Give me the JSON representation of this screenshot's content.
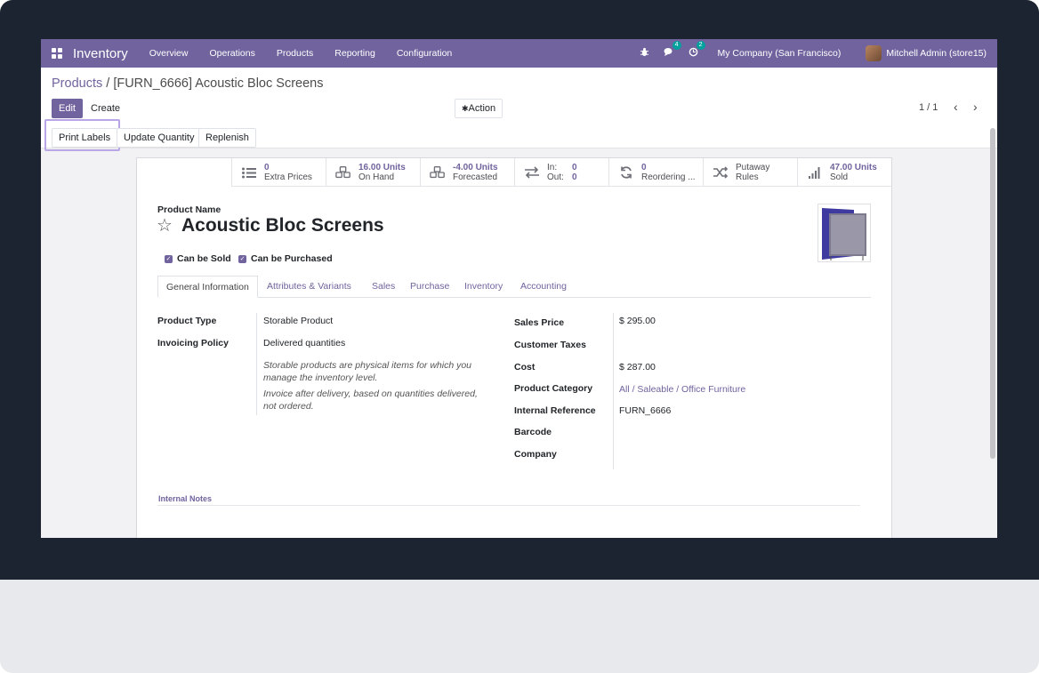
{
  "navbar": {
    "brand": "Inventory",
    "menu": [
      "Overview",
      "Operations",
      "Products",
      "Reporting",
      "Configuration"
    ],
    "messages_badge": "4",
    "activities_badge": "2",
    "company": "My Company (San Francisco)",
    "user": "Mitchell Admin (store15)"
  },
  "breadcrumb": {
    "parent": "Products",
    "separator": "/",
    "current": "[FURN_6666] Acoustic Bloc Screens"
  },
  "control": {
    "edit_label": "Edit",
    "create_label": "Create",
    "action_label": "Action",
    "pager": "1 / 1"
  },
  "statusbar": {
    "print_labels": "Print Labels",
    "update_quantity": "Update Quantity",
    "replenish": "Replenish"
  },
  "smart_buttons": {
    "extra_prices": {
      "value": "0",
      "label": "Extra Prices"
    },
    "on_hand": {
      "value": "16.00 Units",
      "label": "On Hand"
    },
    "forecasted": {
      "value": "-4.00 Units",
      "label": "Forecasted"
    },
    "in_out": {
      "in_label": "In:",
      "in_value": "0",
      "out_label": "Out:",
      "out_value": "0"
    },
    "reordering": {
      "value": "0",
      "label": "Reordering ..."
    },
    "putaway": {
      "line1": "Putaway",
      "line2": "Rules"
    },
    "sold": {
      "value": "47.00 Units",
      "label": "Sold"
    }
  },
  "product": {
    "name_label": "Product Name",
    "name": "Acoustic Bloc Screens",
    "can_be_sold": "Can be Sold",
    "can_be_purchased": "Can be Purchased"
  },
  "tabs": [
    "General Information",
    "Attributes & Variants",
    "Sales",
    "Purchase",
    "Inventory",
    "Accounting"
  ],
  "general": {
    "product_type_label": "Product Type",
    "product_type": "Storable Product",
    "invoicing_policy_label": "Invoicing Policy",
    "invoicing_policy": "Delivered quantities",
    "help_storable": "Storable products are physical items for which you manage the inventory level.",
    "help_invoice": "Invoice after delivery, based on quantities delivered, not ordered.",
    "sales_price_label": "Sales Price",
    "sales_price": "$ 295.00",
    "customer_taxes_label": "Customer Taxes",
    "cost_label": "Cost",
    "cost": "$ 287.00",
    "product_category_label": "Product Category",
    "product_category": "All / Saleable / Office Furniture",
    "internal_reference_label": "Internal Reference",
    "internal_reference": "FURN_6666",
    "barcode_label": "Barcode",
    "company_label": "Company",
    "internal_notes_label": "Internal Notes"
  },
  "colors": {
    "brand": "#71639e",
    "highlight": "#b9a6e6",
    "badge": "#00a09d"
  }
}
